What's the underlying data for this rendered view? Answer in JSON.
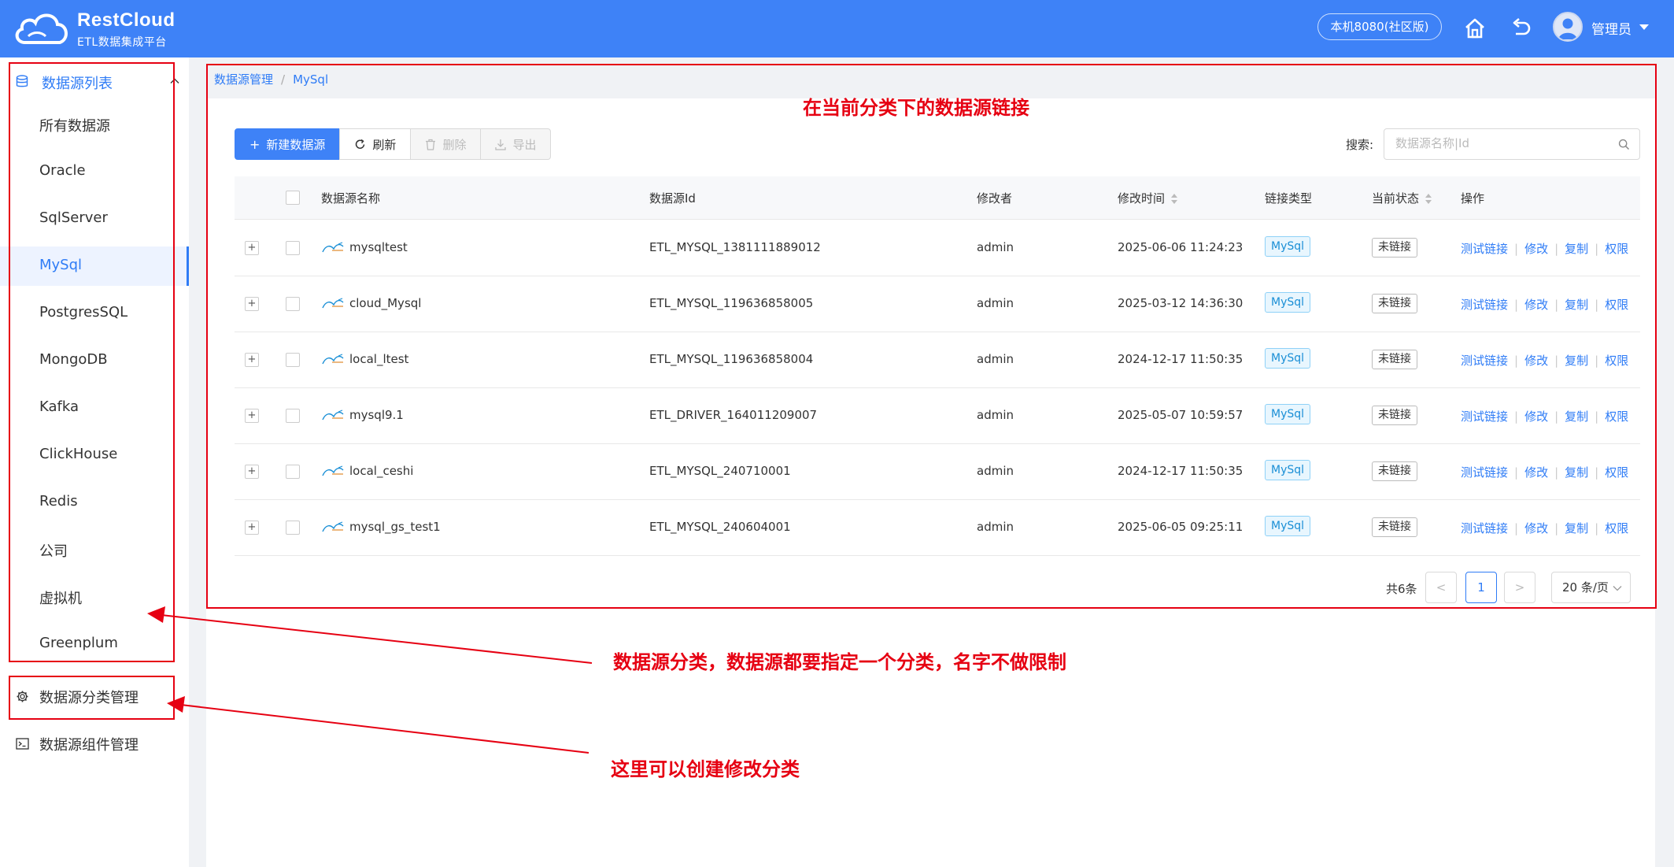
{
  "header": {
    "logo_title": "RestCloud",
    "logo_subtitle": "ETL数据集成平台",
    "host": "本机8080(社区版)",
    "user": "管理员"
  },
  "sidebar": {
    "group": {
      "label": "数据源列表",
      "icon": "database-icon"
    },
    "items": [
      {
        "label": "所有数据源"
      },
      {
        "label": "Oracle"
      },
      {
        "label": "SqlServer"
      },
      {
        "label": "MySql",
        "active": true
      },
      {
        "label": "PostgresSQL"
      },
      {
        "label": "MongoDB"
      },
      {
        "label": "Kafka"
      },
      {
        "label": "ClickHouse"
      },
      {
        "label": "Redis"
      },
      {
        "label": "公司"
      },
      {
        "label": "虚拟机"
      },
      {
        "label": "Greenplum"
      }
    ],
    "category_mgmt": {
      "label": "数据源分类管理",
      "icon": "gear-icon"
    },
    "component_mgmt": {
      "label": "数据源组件管理",
      "icon": "terminal-icon"
    }
  },
  "breadcrumb": [
    "数据源管理",
    "MySql"
  ],
  "toolbar": {
    "new": "新建数据源",
    "refresh": "刷新",
    "delete": "删除",
    "export": "导出"
  },
  "search": {
    "label": "搜索:",
    "placeholder": "数据源名称|Id"
  },
  "table": {
    "columns": [
      "数据源名称",
      "数据源Id",
      "修改者",
      "修改时间",
      "链接类型",
      "当前状态",
      "操作"
    ],
    "rows": [
      {
        "name": "mysqltest",
        "id": "ETL_MYSQL_1381111889012",
        "modifier": "admin",
        "time": "2025-06-06 11:24:23",
        "type": "MySql",
        "status": "未链接"
      },
      {
        "name": "cloud_Mysql",
        "id": "ETL_MYSQL_119636858005",
        "modifier": "admin",
        "time": "2025-03-12 14:36:30",
        "type": "MySql",
        "status": "未链接"
      },
      {
        "name": "local_ltest",
        "id": "ETL_MYSQL_119636858004",
        "modifier": "admin",
        "time": "2024-12-17 11:50:35",
        "type": "MySql",
        "status": "未链接"
      },
      {
        "name": "mysql9.1",
        "id": "ETL_DRIVER_164011209007",
        "modifier": "admin",
        "time": "2025-05-07 10:59:57",
        "type": "MySql",
        "status": "未链接"
      },
      {
        "name": "local_ceshi",
        "id": "ETL_MYSQL_240710001",
        "modifier": "admin",
        "time": "2024-12-17 11:50:35",
        "type": "MySql",
        "status": "未链接"
      },
      {
        "name": "mysql_gs_test1",
        "id": "ETL_MYSQL_240604001",
        "modifier": "admin",
        "time": "2025-06-05 09:25:11",
        "type": "MySql",
        "status": "未链接"
      }
    ],
    "actions": [
      "测试链接",
      "修改",
      "复制",
      "权限"
    ]
  },
  "pagination": {
    "total": "共6条",
    "current": "1",
    "page_size": "20 条/页"
  },
  "annotations": {
    "top": "在当前分类下的数据源链接",
    "middle": "数据源分类，数据源都要指定一个分类，名字不做限制",
    "bottom": "这里可以创建修改分类",
    "color": "#e60012"
  }
}
